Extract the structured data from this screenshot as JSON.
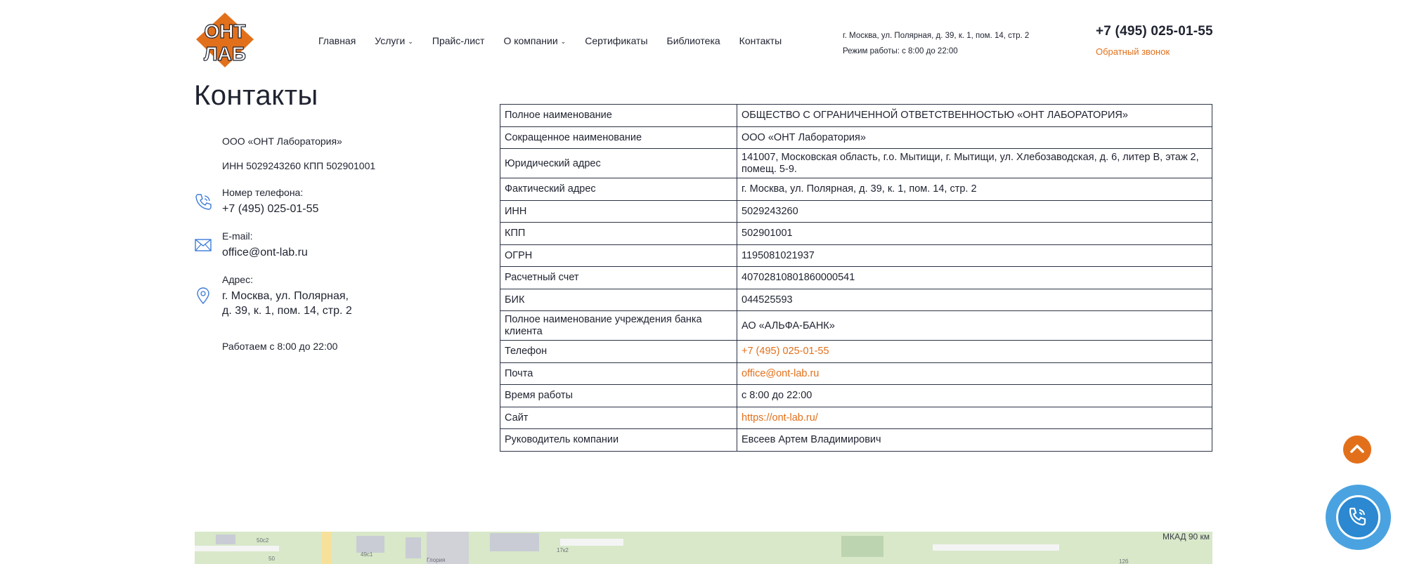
{
  "header": {
    "logo_text": [
      "ОНТ",
      "ЛАБ"
    ],
    "nav": [
      {
        "label": "Главная",
        "dropdown": false
      },
      {
        "label": "Услуги",
        "dropdown": true
      },
      {
        "label": "Прайс-лист",
        "dropdown": false
      },
      {
        "label": "О компании",
        "dropdown": true
      },
      {
        "label": "Сертификаты",
        "dropdown": false
      },
      {
        "label": "Библиотека",
        "dropdown": false
      },
      {
        "label": "Контакты",
        "dropdown": false
      }
    ],
    "address": "г. Москва, ул. Полярная, д. 39, к. 1, пом. 14, стр. 2",
    "hours": "Режим работы: с 8:00 до 22:00",
    "phone": "+7 (495) 025-01-55",
    "callback": "Обратный звонок"
  },
  "page": {
    "title": "Контакты"
  },
  "contacts": {
    "company": "ООО «ОНТ Лаборатория»",
    "inn_kpp": "ИНН 5029243260 КПП 502901001",
    "phone_label": "Номер телефона:",
    "phone": "+7 (495) 025-01-55",
    "email_label": "E-mail:",
    "email": "office@ont-lab.ru",
    "address_label": "Адрес:",
    "address_line1": "г. Москва, ул. Полярная,",
    "address_line2": "д. 39, к. 1, пом. 14, стр. 2",
    "hours": "Работаем с 8:00 до 22:00"
  },
  "requisites": [
    {
      "key": "Полное наименование",
      "value": "ОБЩЕСТВО С ОГРАНИЧЕННОЙ ОТВЕТСТВЕННОСТЬЮ «ОНТ ЛАБОРАТОРИЯ»"
    },
    {
      "key": "Сокращенное наименование",
      "value": "ООО «ОНТ Лаборатория»"
    },
    {
      "key": "Юридический адрес",
      "value": "141007, Московская область, г.о. Мытищи, г. Мытищи, ул. Хлебозаводская, д. 6, литер В, этаж 2, помещ. 5-9."
    },
    {
      "key": "Фактический адрес",
      "value": "г. Москва, ул. Полярная, д. 39, к. 1, пом. 14, стр. 2"
    },
    {
      "key": "ИНН",
      "value": "5029243260"
    },
    {
      "key": "КПП",
      "value": "502901001"
    },
    {
      "key": "ОГРН",
      "value": "1195081021937"
    },
    {
      "key": "Расчетный счет",
      "value": "40702810801860000541"
    },
    {
      "key": "БИК",
      "value": "044525593"
    },
    {
      "key": "Полное наименование учреждения банка клиента",
      "value": "АО «АЛЬФА-БАНК»"
    },
    {
      "key": "Телефон",
      "value": "+7 (495) 025-01-55",
      "link": true
    },
    {
      "key": "Почта",
      "value": "office@ont-lab.ru",
      "link": true
    },
    {
      "key": "Время работы",
      "value": "с 8:00 до 22:00"
    },
    {
      "key": "Сайт",
      "value": "https://ont-lab.ru/",
      "link": true
    },
    {
      "key": "Руководитель компании",
      "value": "Евсеев Артем Владимирович"
    }
  ],
  "map": {
    "labels": [
      "50с2",
      "50",
      "49с1",
      "Глория",
      "17к2",
      "12б"
    ],
    "mkad": "МКАД 90 км"
  },
  "colors": {
    "accent": "#e2701b",
    "text": "#1f2330",
    "call_button": "#4aa3e0",
    "icon": "#3d7bd9"
  },
  "icons": {
    "phone": "phone-icon",
    "email": "envelope-icon",
    "address": "map-pin-icon",
    "scroll_top": "chevron-up-icon",
    "call": "phone-call-icon"
  }
}
